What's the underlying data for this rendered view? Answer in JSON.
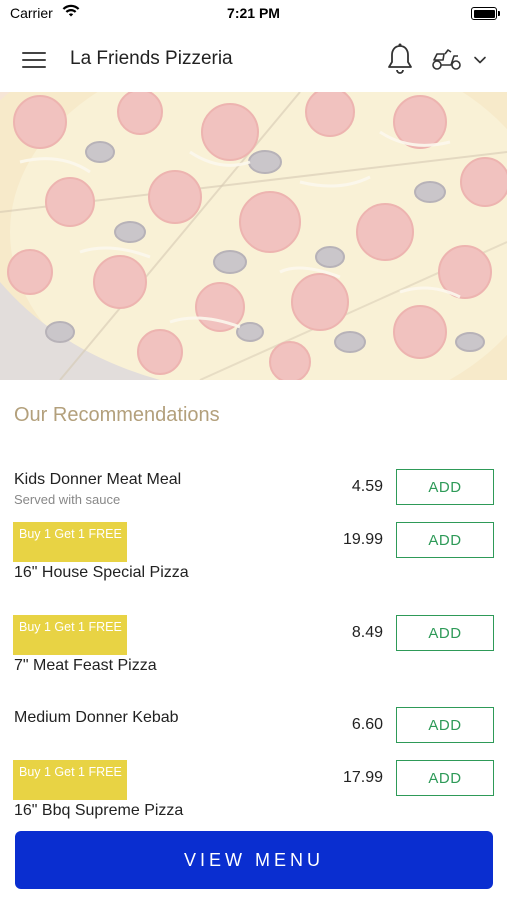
{
  "status_bar": {
    "carrier": "Carrier",
    "time": "7:21 PM"
  },
  "header": {
    "title": "La Friends Pizzeria"
  },
  "section": {
    "title": "Our Recommendations"
  },
  "items": [
    {
      "name": "Kids Donner Meat Meal",
      "description": "Served with sauce",
      "price": "4.59",
      "add_label": "ADD",
      "promo": ""
    },
    {
      "name": "16\" House Special Pizza",
      "description": "",
      "price": "19.99",
      "add_label": "ADD",
      "promo": "Buy 1 Get 1 FREE"
    },
    {
      "name": "7\" Meat Feast Pizza",
      "description": "",
      "price": "8.49",
      "add_label": "ADD",
      "promo": "Buy 1 Get 1 FREE"
    },
    {
      "name": "Medium Donner Kebab",
      "description": "",
      "price": "6.60",
      "add_label": "ADD",
      "promo": ""
    },
    {
      "name": "16\" Bbq Supreme Pizza",
      "description": "",
      "price": "17.99",
      "add_label": "ADD",
      "promo": "Buy 1 Get 1 FREE"
    }
  ],
  "footer": {
    "view_menu_label": "VIEW MENU"
  },
  "colors": {
    "accent_blue": "#0a2ed0",
    "add_green": "#2e9a58",
    "promo_yellow": "#e8d344",
    "section_title": "#b3a07c"
  },
  "icons": [
    "wifi-icon",
    "battery-icon",
    "hamburger-menu-icon",
    "bell-icon",
    "delivery-scooter-icon",
    "chevron-down-icon"
  ]
}
